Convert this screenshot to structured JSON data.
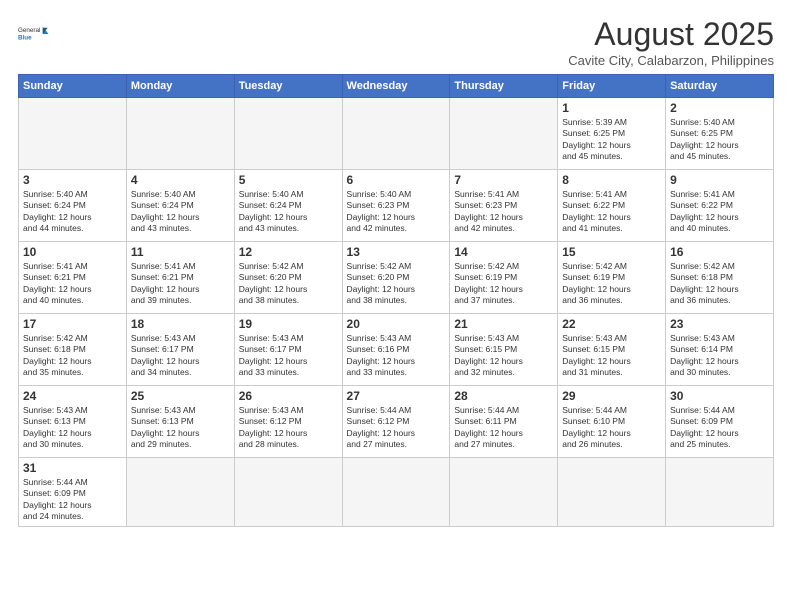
{
  "header": {
    "logo_general": "General",
    "logo_blue": "Blue",
    "month_year": "August 2025",
    "location": "Cavite City, Calabarzon, Philippines"
  },
  "days_of_week": [
    "Sunday",
    "Monday",
    "Tuesday",
    "Wednesday",
    "Thursday",
    "Friday",
    "Saturday"
  ],
  "weeks": [
    [
      {
        "day": "",
        "info": ""
      },
      {
        "day": "",
        "info": ""
      },
      {
        "day": "",
        "info": ""
      },
      {
        "day": "",
        "info": ""
      },
      {
        "day": "",
        "info": ""
      },
      {
        "day": "1",
        "info": "Sunrise: 5:39 AM\nSunset: 6:25 PM\nDaylight: 12 hours\nand 45 minutes."
      },
      {
        "day": "2",
        "info": "Sunrise: 5:40 AM\nSunset: 6:25 PM\nDaylight: 12 hours\nand 45 minutes."
      }
    ],
    [
      {
        "day": "3",
        "info": "Sunrise: 5:40 AM\nSunset: 6:24 PM\nDaylight: 12 hours\nand 44 minutes."
      },
      {
        "day": "4",
        "info": "Sunrise: 5:40 AM\nSunset: 6:24 PM\nDaylight: 12 hours\nand 43 minutes."
      },
      {
        "day": "5",
        "info": "Sunrise: 5:40 AM\nSunset: 6:24 PM\nDaylight: 12 hours\nand 43 minutes."
      },
      {
        "day": "6",
        "info": "Sunrise: 5:40 AM\nSunset: 6:23 PM\nDaylight: 12 hours\nand 42 minutes."
      },
      {
        "day": "7",
        "info": "Sunrise: 5:41 AM\nSunset: 6:23 PM\nDaylight: 12 hours\nand 42 minutes."
      },
      {
        "day": "8",
        "info": "Sunrise: 5:41 AM\nSunset: 6:22 PM\nDaylight: 12 hours\nand 41 minutes."
      },
      {
        "day": "9",
        "info": "Sunrise: 5:41 AM\nSunset: 6:22 PM\nDaylight: 12 hours\nand 40 minutes."
      }
    ],
    [
      {
        "day": "10",
        "info": "Sunrise: 5:41 AM\nSunset: 6:21 PM\nDaylight: 12 hours\nand 40 minutes."
      },
      {
        "day": "11",
        "info": "Sunrise: 5:41 AM\nSunset: 6:21 PM\nDaylight: 12 hours\nand 39 minutes."
      },
      {
        "day": "12",
        "info": "Sunrise: 5:42 AM\nSunset: 6:20 PM\nDaylight: 12 hours\nand 38 minutes."
      },
      {
        "day": "13",
        "info": "Sunrise: 5:42 AM\nSunset: 6:20 PM\nDaylight: 12 hours\nand 38 minutes."
      },
      {
        "day": "14",
        "info": "Sunrise: 5:42 AM\nSunset: 6:19 PM\nDaylight: 12 hours\nand 37 minutes."
      },
      {
        "day": "15",
        "info": "Sunrise: 5:42 AM\nSunset: 6:19 PM\nDaylight: 12 hours\nand 36 minutes."
      },
      {
        "day": "16",
        "info": "Sunrise: 5:42 AM\nSunset: 6:18 PM\nDaylight: 12 hours\nand 36 minutes."
      }
    ],
    [
      {
        "day": "17",
        "info": "Sunrise: 5:42 AM\nSunset: 6:18 PM\nDaylight: 12 hours\nand 35 minutes."
      },
      {
        "day": "18",
        "info": "Sunrise: 5:43 AM\nSunset: 6:17 PM\nDaylight: 12 hours\nand 34 minutes."
      },
      {
        "day": "19",
        "info": "Sunrise: 5:43 AM\nSunset: 6:17 PM\nDaylight: 12 hours\nand 33 minutes."
      },
      {
        "day": "20",
        "info": "Sunrise: 5:43 AM\nSunset: 6:16 PM\nDaylight: 12 hours\nand 33 minutes."
      },
      {
        "day": "21",
        "info": "Sunrise: 5:43 AM\nSunset: 6:15 PM\nDaylight: 12 hours\nand 32 minutes."
      },
      {
        "day": "22",
        "info": "Sunrise: 5:43 AM\nSunset: 6:15 PM\nDaylight: 12 hours\nand 31 minutes."
      },
      {
        "day": "23",
        "info": "Sunrise: 5:43 AM\nSunset: 6:14 PM\nDaylight: 12 hours\nand 30 minutes."
      }
    ],
    [
      {
        "day": "24",
        "info": "Sunrise: 5:43 AM\nSunset: 6:13 PM\nDaylight: 12 hours\nand 30 minutes."
      },
      {
        "day": "25",
        "info": "Sunrise: 5:43 AM\nSunset: 6:13 PM\nDaylight: 12 hours\nand 29 minutes."
      },
      {
        "day": "26",
        "info": "Sunrise: 5:43 AM\nSunset: 6:12 PM\nDaylight: 12 hours\nand 28 minutes."
      },
      {
        "day": "27",
        "info": "Sunrise: 5:44 AM\nSunset: 6:12 PM\nDaylight: 12 hours\nand 27 minutes."
      },
      {
        "day": "28",
        "info": "Sunrise: 5:44 AM\nSunset: 6:11 PM\nDaylight: 12 hours\nand 27 minutes."
      },
      {
        "day": "29",
        "info": "Sunrise: 5:44 AM\nSunset: 6:10 PM\nDaylight: 12 hours\nand 26 minutes."
      },
      {
        "day": "30",
        "info": "Sunrise: 5:44 AM\nSunset: 6:09 PM\nDaylight: 12 hours\nand 25 minutes."
      }
    ],
    [
      {
        "day": "31",
        "info": "Sunrise: 5:44 AM\nSunset: 6:09 PM\nDaylight: 12 hours\nand 24 minutes."
      },
      {
        "day": "",
        "info": ""
      },
      {
        "day": "",
        "info": ""
      },
      {
        "day": "",
        "info": ""
      },
      {
        "day": "",
        "info": ""
      },
      {
        "day": "",
        "info": ""
      },
      {
        "day": "",
        "info": ""
      }
    ]
  ]
}
